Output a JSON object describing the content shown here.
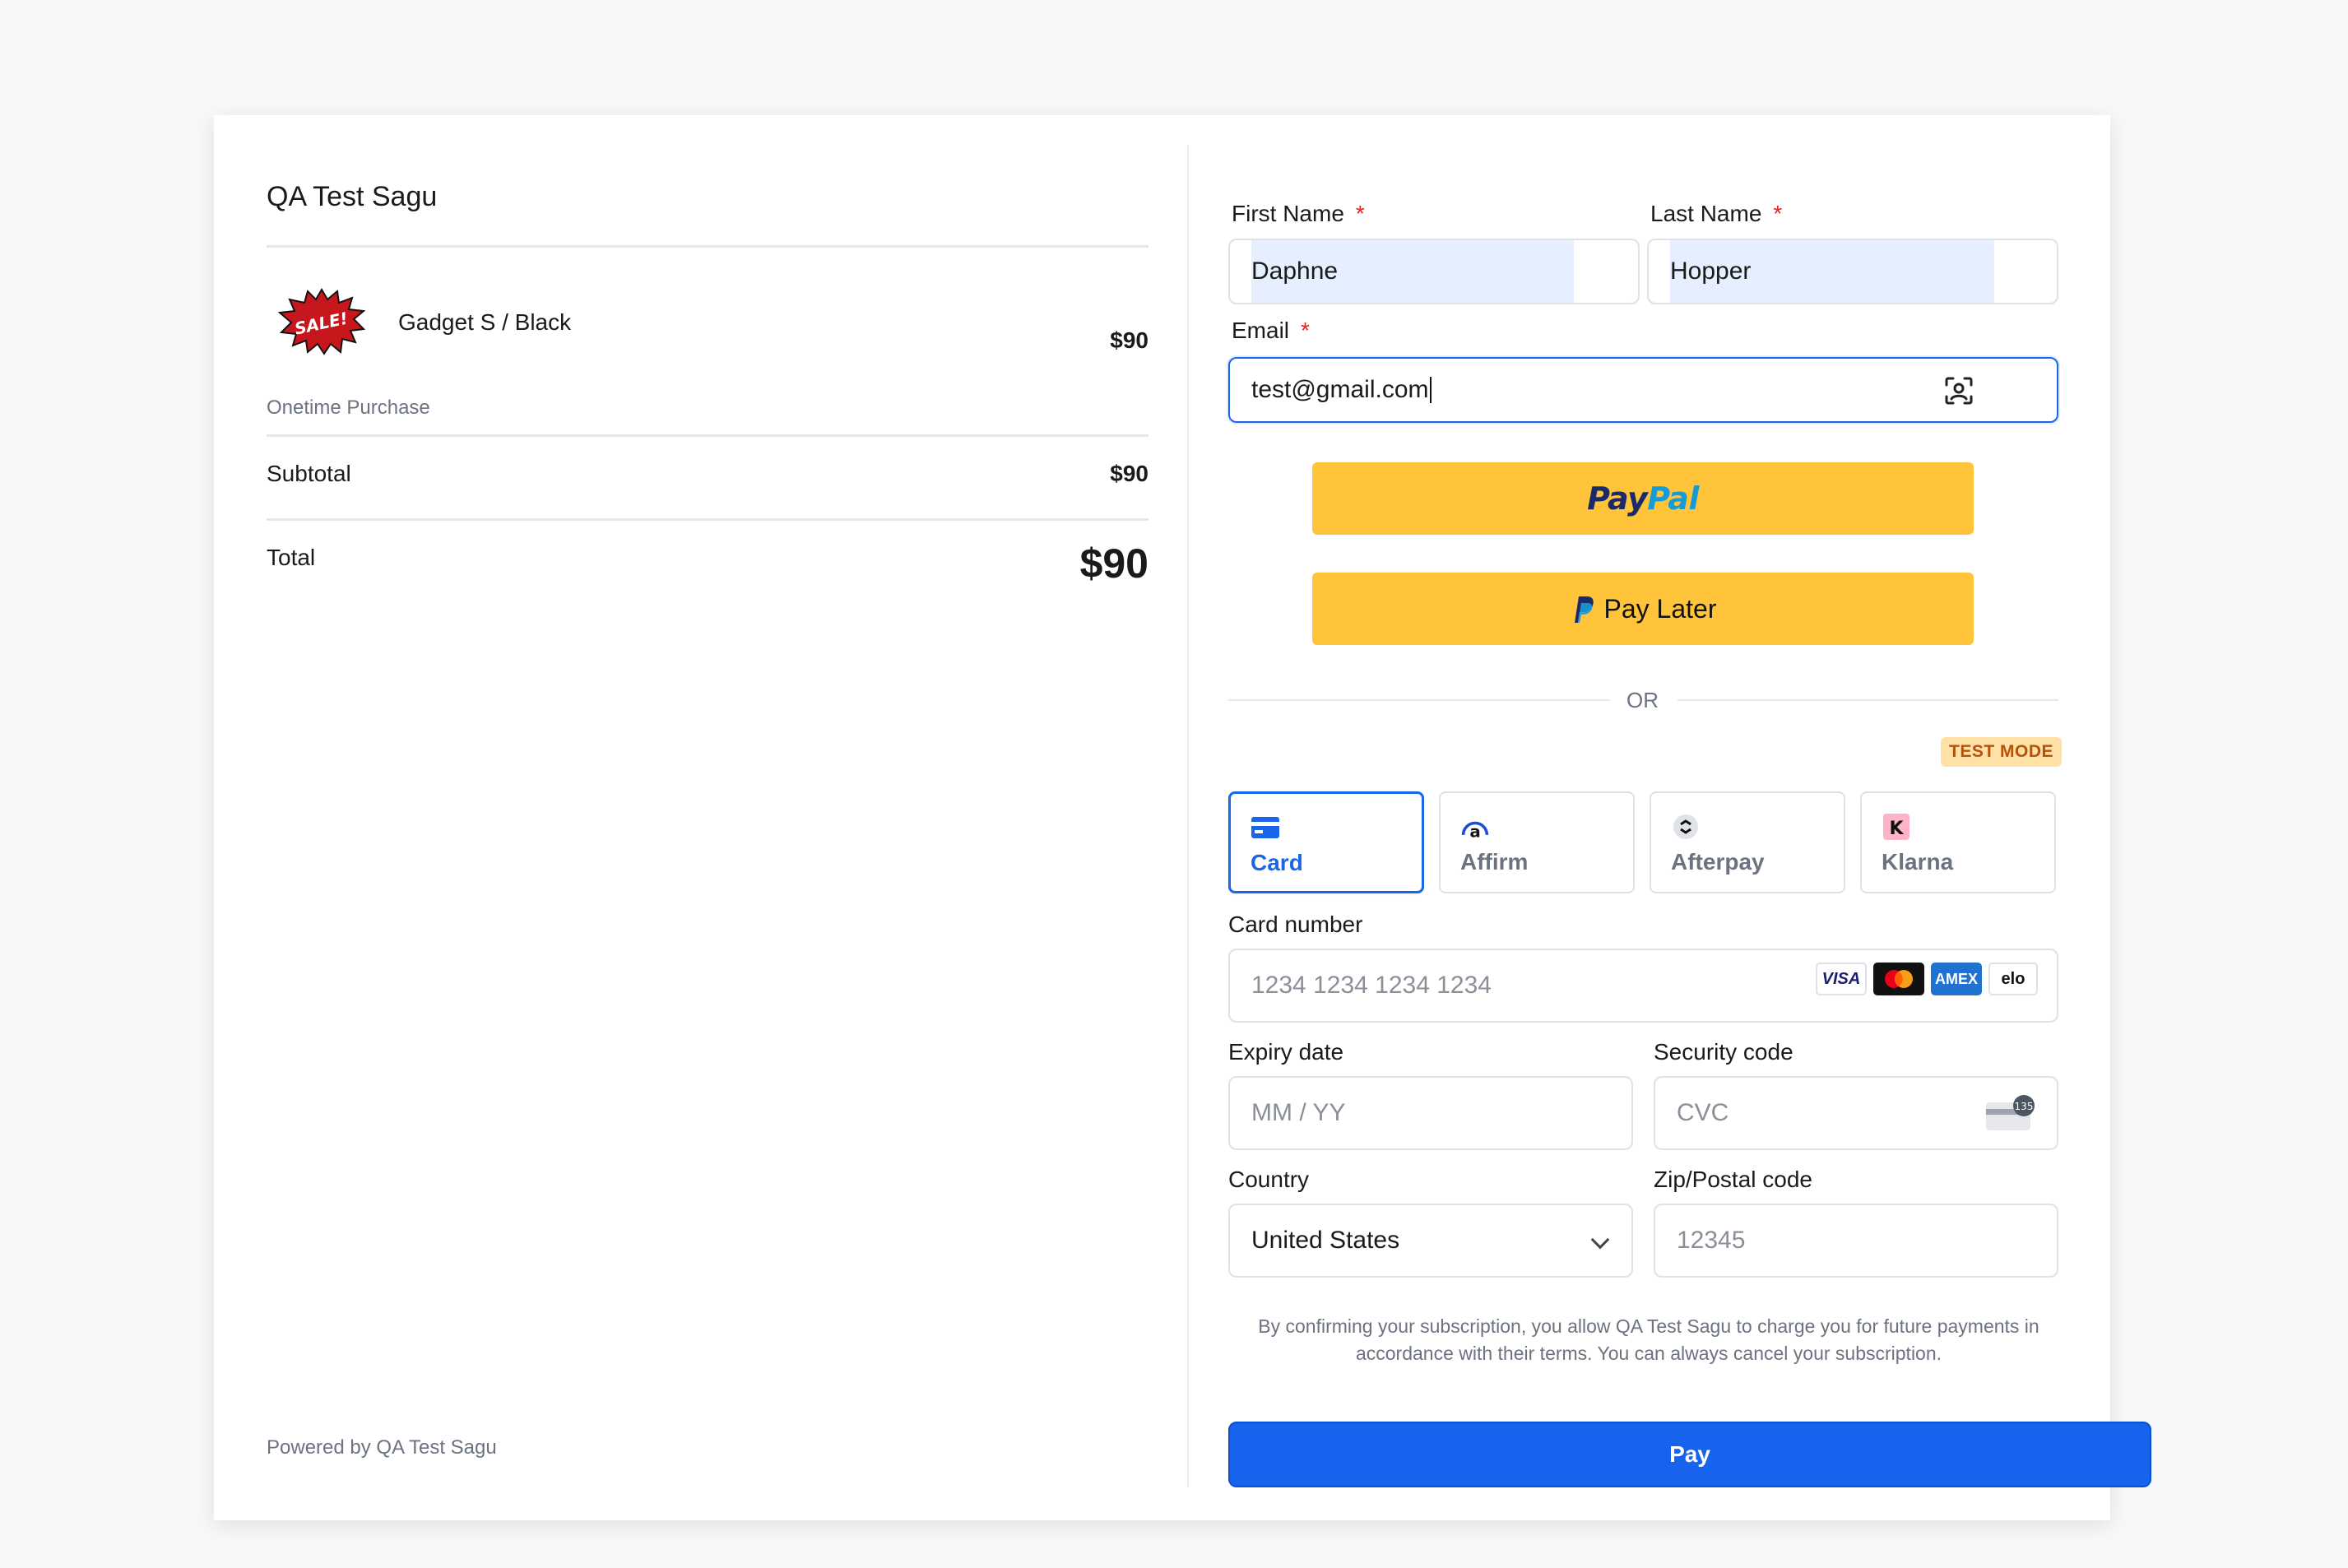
{
  "order": {
    "shop_name": "QA Test Sagu",
    "product": {
      "name": "Gadget S / Black",
      "price": "$90",
      "image_text": "SALE!"
    },
    "purchase_type": "Onetime Purchase",
    "subtotal_label": "Subtotal",
    "subtotal_value": "$90",
    "total_label": "Total",
    "total_value": "$90",
    "powered_by": "Powered by QA Test Sagu"
  },
  "form": {
    "first_name_label": "First Name",
    "first_name_value": "Daphne",
    "last_name_label": "Last Name",
    "last_name_value": "Hopper",
    "email_label": "Email",
    "email_value": "test@gmail.com",
    "required_mark": "*"
  },
  "express": {
    "paypal_pay": "Pay",
    "paypal_pal": "Pal",
    "paylater_label": "Pay Later",
    "or_text": "OR"
  },
  "payment": {
    "test_mode_badge": "TEST MODE",
    "tabs": [
      {
        "label": "Card",
        "icon": "card-icon",
        "active": true
      },
      {
        "label": "Affirm",
        "icon": "affirm-icon",
        "active": false
      },
      {
        "label": "Afterpay",
        "icon": "afterpay-icon",
        "active": false
      },
      {
        "label": "Klarna",
        "icon": "klarna-icon",
        "active": false
      }
    ],
    "card_number_label": "Card number",
    "card_number_placeholder": "1234 1234 1234 1234",
    "brands": [
      "VISA",
      "mastercard",
      "AMEX",
      "elo"
    ],
    "expiry_label": "Expiry date",
    "expiry_placeholder": "MM / YY",
    "cvc_label": "Security code",
    "cvc_placeholder": "CVC",
    "cvc_icon_text": "135",
    "country_label": "Country",
    "country_value": "United States",
    "zip_label": "Zip/Postal code",
    "zip_placeholder": "12345"
  },
  "consent_text": "By confirming your subscription, you allow QA Test Sagu to charge you for future payments in accordance with their terms. You can always cancel your subscription.",
  "pay_button": "Pay",
  "colors": {
    "accent": "#1763ee",
    "paypal_yellow": "#ffc43a",
    "required": "#e02424",
    "autofill": "#e6efff"
  }
}
